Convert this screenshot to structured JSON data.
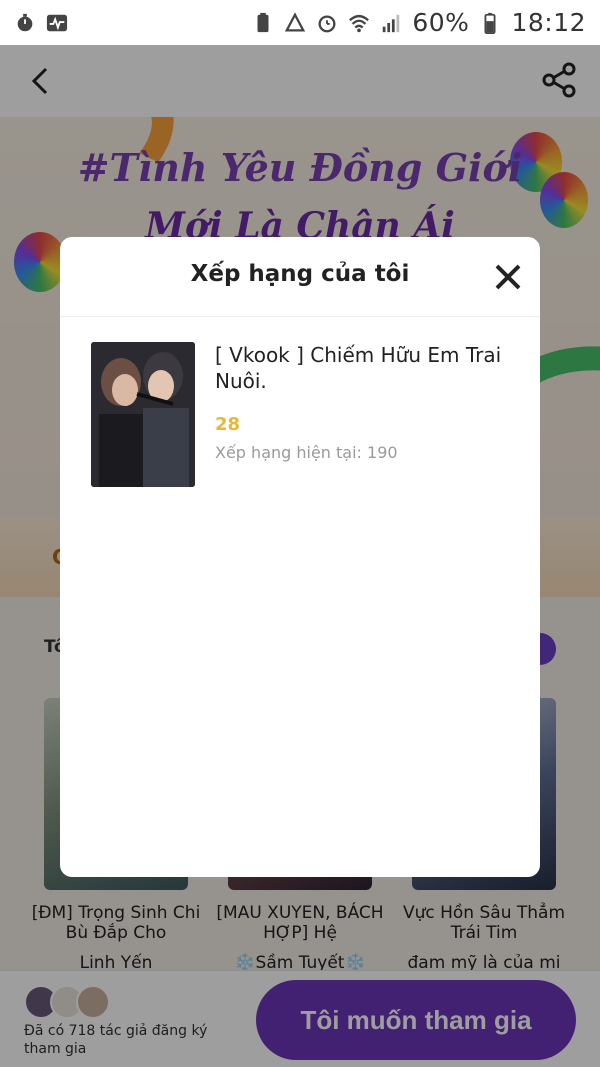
{
  "status_bar": {
    "battery": "60%",
    "time": "18:12"
  },
  "banner": {
    "title_line1": "#Tình Yêu Đồng Giới",
    "title_line2": "Mới Là Chân Ái"
  },
  "tabs": {
    "first_initial": "G"
  },
  "section": {
    "label_initial": "Tô"
  },
  "cards": [
    {
      "title": "[ĐM] Trọng Sinh Chi Bù Đắp Cho",
      "author": "Linh Yến"
    },
    {
      "title": "[MAU XUYEN, BÁCH HỢP] Hệ",
      "author": "❄️Sầm Tuyết❄️"
    },
    {
      "title": "Vực Hồn Sâu Thẳm Trái Tim",
      "author": "đam mỹ là của mi"
    }
  ],
  "footer": {
    "registered_text": "Đã có 718 tác giả đăng ký tham gia",
    "join_button": "Tôi muốn tham gia"
  },
  "modal": {
    "title": "Xếp hạng của tôi",
    "item": {
      "title": "[ Vkook ] Chiếm Hữu Em Trai Nuôi.",
      "score": "28",
      "current_rank": "Xếp hạng hiện tại: 190"
    }
  },
  "colors": {
    "accent_purple": "#6d36b8",
    "score_gold": "#e8b83a"
  }
}
